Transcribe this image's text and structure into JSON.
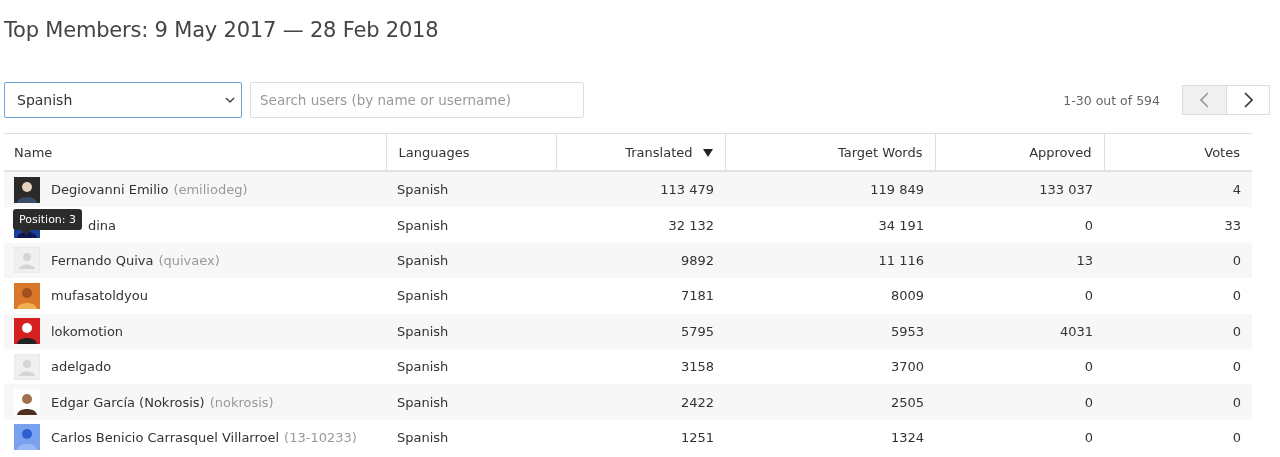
{
  "title": "Top Members: 9 May 2017 — 28 Feb 2018",
  "language_select": {
    "value": "Spanish"
  },
  "search": {
    "placeholder": "Search users (by name or username)"
  },
  "pagination": {
    "range": "1-30 out of 594"
  },
  "table": {
    "columns": [
      {
        "label": "Name",
        "sorted": false
      },
      {
        "label": "Languages",
        "sorted": false
      },
      {
        "label": "Translated",
        "sorted": true
      },
      {
        "label": "Target Words",
        "sorted": false
      },
      {
        "label": "Approved",
        "sorted": false
      },
      {
        "label": "Votes",
        "sorted": false
      }
    ],
    "rows": [
      {
        "name": "Degiovanni Emilio",
        "username": "(emiliodeg)",
        "language": "Spanish",
        "translated": "113 479",
        "target_words": "119 849",
        "approved": "133 037",
        "votes": "4"
      },
      {
        "name": "dina",
        "tooltip": "Position: 3",
        "language": "Spanish",
        "translated": "32 132",
        "target_words": "34 191",
        "approved": "0",
        "votes": "33"
      },
      {
        "kind": "default",
        "name": "Fernando Quiva",
        "username": "(quivaex)",
        "language": "Spanish",
        "translated": "9892",
        "target_words": "11 116",
        "approved": "13",
        "votes": "0"
      },
      {
        "name": "mufasatoldyou",
        "language": "Spanish",
        "translated": "7181",
        "target_words": "8009",
        "approved": "0",
        "votes": "0"
      },
      {
        "name": "lokomotion",
        "language": "Spanish",
        "translated": "5795",
        "target_words": "5953",
        "approved": "4031",
        "votes": "0"
      },
      {
        "kind": "default",
        "name": "adelgado",
        "language": "Spanish",
        "translated": "3158",
        "target_words": "3700",
        "approved": "0",
        "votes": "0"
      },
      {
        "name": "Edgar García (Nokrosis)",
        "username": "(nokrosis)",
        "language": "Spanish",
        "translated": "2422",
        "target_words": "2505",
        "approved": "0",
        "votes": "0"
      },
      {
        "name": "Carlos Benicio Carrasquel Villarroel",
        "username": "(13-10233)",
        "language": "Spanish",
        "translated": "1251",
        "target_words": "1324",
        "approved": "0",
        "votes": "0"
      }
    ]
  }
}
